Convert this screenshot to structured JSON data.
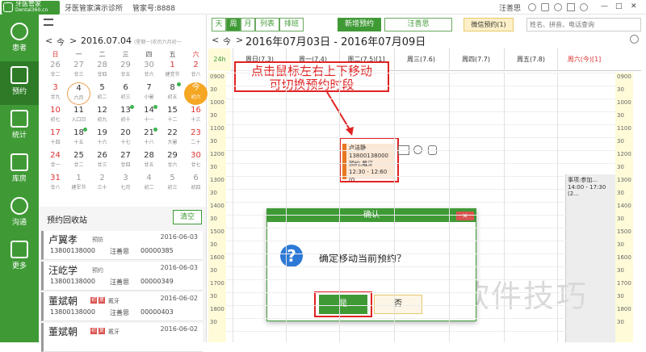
{
  "topbar": {
    "logo_main": "牙医管家",
    "logo_sub": "Dental360.cn",
    "clinic": "牙医管家演示诊所",
    "account": "管家号:8888",
    "user": "汪善思",
    "controls": [
      "—",
      "□",
      "✕"
    ]
  },
  "nav": [
    {
      "label": "患者",
      "icon": "person-icon"
    },
    {
      "label": "预约",
      "icon": "calendar-icon"
    },
    {
      "label": "统计",
      "icon": "chart-icon"
    },
    {
      "label": "库房",
      "icon": "warehouse-icon"
    },
    {
      "label": "沟通",
      "icon": "chat-icon"
    },
    {
      "label": "更多",
      "icon": "grid-icon"
    }
  ],
  "calendar": {
    "prev": "<",
    "today_btn": "今",
    "next": ">",
    "date": "2016.07.04",
    "sub": "(星期一)农历六月初一",
    "week_headers": [
      "日",
      "一",
      "二",
      "三",
      "四",
      "五",
      "六"
    ],
    "rows": [
      [
        {
          "d": "26",
          "l": "廿二",
          "c": "grey"
        },
        {
          "d": "27",
          "l": "廿三",
          "c": "grey"
        },
        {
          "d": "28",
          "l": "廿四",
          "c": "grey"
        },
        {
          "d": "29",
          "l": "廿五",
          "c": "grey"
        },
        {
          "d": "30",
          "l": "廿六",
          "c": "grey"
        },
        {
          "d": "1",
          "l": "建党节",
          "c": "red"
        },
        {
          "d": "2",
          "l": "廿八",
          "c": "red"
        }
      ],
      [
        {
          "d": "3",
          "l": "廿九",
          "c": "red"
        },
        {
          "d": "4",
          "l": "六月",
          "c": "today"
        },
        {
          "d": "5",
          "l": "初二"
        },
        {
          "d": "6",
          "l": "初三"
        },
        {
          "d": "7",
          "l": "小暑"
        },
        {
          "d": "8",
          "l": "初五",
          "dot": true
        },
        {
          "d": "今",
          "l": "初六",
          "c": "sel"
        }
      ],
      [
        {
          "d": "10",
          "l": "初七",
          "c": "red"
        },
        {
          "d": "11",
          "l": "入口日"
        },
        {
          "d": "12",
          "l": "初九"
        },
        {
          "d": "13",
          "l": "初十",
          "dot": true
        },
        {
          "d": "14",
          "l": "十一",
          "dot": true
        },
        {
          "d": "15",
          "l": "十二"
        },
        {
          "d": "16",
          "l": "十三",
          "c": "red"
        }
      ],
      [
        {
          "d": "17",
          "l": "十四",
          "c": "red"
        },
        {
          "d": "18",
          "l": "十五",
          "dot": true
        },
        {
          "d": "19",
          "l": "十六"
        },
        {
          "d": "20",
          "l": "十七"
        },
        {
          "d": "21",
          "l": "十八",
          "dot": true
        },
        {
          "d": "22",
          "l": "大暑"
        },
        {
          "d": "23",
          "l": "二十",
          "c": "red"
        }
      ],
      [
        {
          "d": "24",
          "l": "廿一",
          "c": "red"
        },
        {
          "d": "25",
          "l": "廿二"
        },
        {
          "d": "26",
          "l": "廿三"
        },
        {
          "d": "27",
          "l": "廿四"
        },
        {
          "d": "28",
          "l": "廿五"
        },
        {
          "d": "29",
          "l": "廿六"
        },
        {
          "d": "30",
          "l": "廿七",
          "c": "red"
        }
      ],
      [
        {
          "d": "31",
          "l": "廿八",
          "c": "red"
        },
        {
          "d": "1",
          "l": "建军节",
          "c": "grey"
        },
        {
          "d": "2",
          "l": "三十",
          "c": "grey"
        },
        {
          "d": "3",
          "l": "七月",
          "c": "grey"
        },
        {
          "d": "4",
          "l": "初二",
          "c": "grey"
        },
        {
          "d": "5",
          "l": "初三",
          "c": "grey"
        },
        {
          "d": "6",
          "l": "初四",
          "c": "grey"
        }
      ]
    ]
  },
  "recycle": {
    "title": "预约回收站",
    "clear": "清空",
    "items": [
      {
        "name": "卢翼孝",
        "tag": "预防",
        "date": "2016-06-03",
        "phone": "13800138000",
        "doctor": "汪善思",
        "no": "00000385",
        "badges": []
      },
      {
        "name": "汪屹学",
        "tag": "预约",
        "date": "2016-06-03",
        "phone": "13800138000",
        "doctor": "汪善思",
        "no": "00000349",
        "badges": []
      },
      {
        "name": "董斌朝",
        "tag": "戴牙",
        "date": "2016-06-02",
        "phone": "13800138000",
        "doctor": "汪善思",
        "no": "00000403",
        "badges": [
          "初",
          "复"
        ]
      },
      {
        "name": "董斌朝",
        "tag": "戴牙",
        "date": "2016-06-02",
        "phone": "",
        "doctor": "",
        "no": "",
        "badges": [
          "初",
          "复"
        ]
      }
    ]
  },
  "toolbar": {
    "views": [
      "天",
      "周",
      "月",
      "列表",
      "排班"
    ],
    "active_view": "周",
    "new_btn": "新增预约",
    "doctor_select": "汪善思",
    "wechat_btn": "微信预约(1)",
    "search_placeholder": "姓名、拼音、电话查询"
  },
  "schedule": {
    "prev": "<",
    "today": "今",
    "next": ">",
    "range": "2016年07月03日 - 2016年07月09日",
    "col24": "24h",
    "days": [
      "周日(7.3)",
      "周一(7.4)",
      "周二(7.5)[1]",
      "周三(7.6)",
      "周四(7.7)",
      "周五(7.8)",
      "周六(今)[1]"
    ],
    "hours": [
      "09",
      "10",
      "11",
      "12",
      "13",
      "14",
      "15",
      "16",
      "17",
      "18"
    ],
    "half": "30",
    "zero": "00"
  },
  "appointment": {
    "name": "卢洁静",
    "phone": "13800138000",
    "type": "预约,戴牙",
    "time": "12:30 - 12:60 (0.."
  },
  "side_appt": {
    "title": "事项:参加...",
    "time": "14:00 - 17:30 (2..."
  },
  "tip": {
    "line1": "点击鼠标左右上下移动",
    "line2": "可切换预约时段"
  },
  "dialog": {
    "title": "确认",
    "close": "✕",
    "message": "确定移动当前预约？",
    "yes": "是",
    "no": "否"
  },
  "watermark": "软件技巧",
  "colors": {
    "brand": "#3f9a36",
    "accent": "#e02222",
    "appt": "#e87722"
  }
}
